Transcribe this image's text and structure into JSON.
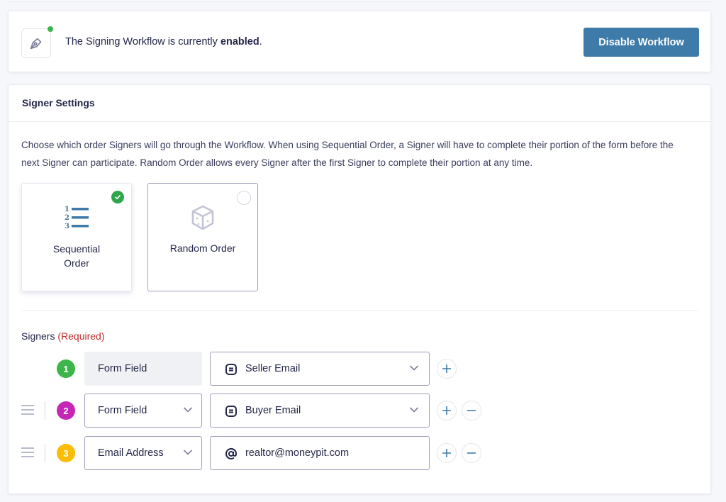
{
  "status": {
    "text_prefix": "The Signing Workflow is currently ",
    "state": "enabled",
    "text_suffix": ".",
    "indicator_color": "#3cb54a",
    "disable_button_label": "Disable Workflow",
    "button_color": "#3e7ba8"
  },
  "signer_settings": {
    "title": "Signer Settings",
    "description": "Choose which order Signers will go through the Workflow. When using Sequential Order, a Signer will have to complete their portion of the form before the next Signer can participate. Random Order allows every Signer after the first Signer to complete their portion at any time.",
    "order_options": [
      {
        "label_line1": "Sequential",
        "label_line2": "Order",
        "icon": "numbered-list-icon",
        "selected": true
      },
      {
        "label": "Random Order",
        "icon": "dice-icon",
        "selected": false
      }
    ],
    "signers_label": "Signers",
    "required_label": "(Required)",
    "signers": [
      {
        "number": "1",
        "badge_color": "#3cb54a",
        "type": "Form Field",
        "type_editable": false,
        "value": "Seller Email",
        "value_icon": "form-field-icon",
        "value_is_dropdown": true,
        "removable": false
      },
      {
        "number": "2",
        "badge_color": "#c526b5",
        "type": "Form Field",
        "type_editable": true,
        "value": "Buyer Email",
        "value_icon": "form-field-icon",
        "value_is_dropdown": true,
        "removable": true
      },
      {
        "number": "3",
        "badge_color": "#fbbc05",
        "type": "Email Address",
        "type_editable": true,
        "value": "realtor@moneypit.com",
        "value_icon": "at-sign-icon",
        "value_is_dropdown": false,
        "removable": true
      }
    ]
  }
}
